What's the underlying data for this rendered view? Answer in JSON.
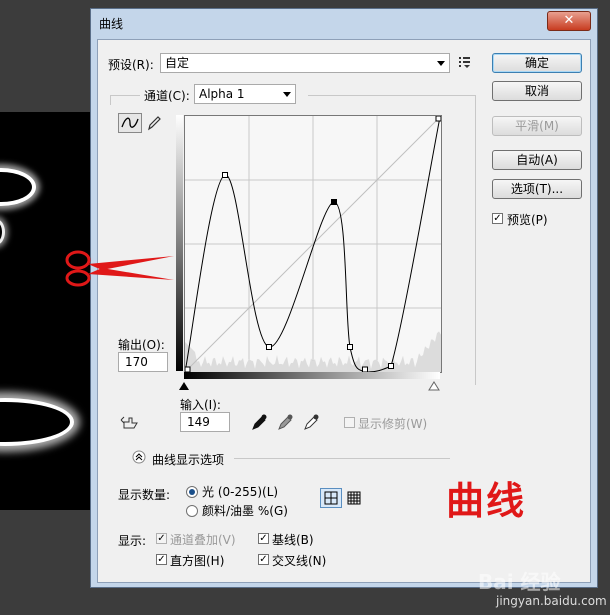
{
  "title": "曲线",
  "close_label": "✕",
  "preset": {
    "label": "预设(R):",
    "value": "自定"
  },
  "channel": {
    "label": "通道(C):",
    "value": "Alpha 1"
  },
  "buttons": {
    "ok": "确定",
    "cancel": "取消",
    "smooth": "平滑(M)",
    "auto": "自动(A)",
    "options": "选项(T)..."
  },
  "preview_label": "预览(P)",
  "output": {
    "label": "输出(O):",
    "value": "170"
  },
  "input": {
    "label": "输入(I):",
    "value": "149"
  },
  "show_clipping_label": "显示修剪(W)",
  "curve_display_options_label": "曲线显示选项",
  "show_amount": {
    "label": "显示数量:",
    "light": "光 (0-255)(L)",
    "pigment": "颜料/油墨 %(G)",
    "selected": "light"
  },
  "show": {
    "label": "显示:",
    "channel_overlays": "通道叠加(V)",
    "baseline": "基线(B)",
    "histogram": "直方图(H)",
    "intersection": "交叉线(N)"
  },
  "annotation": "曲线",
  "watermark": {
    "brand": "Bai 经验",
    "url": "jingyan.baidu.com"
  },
  "colors": {
    "dialog_border": "#5a6e88",
    "annotation_red": "#e01818"
  },
  "curve_points": [
    [
      0,
      0
    ],
    [
      40,
      197
    ],
    [
      84,
      25
    ],
    [
      149,
      170
    ],
    [
      165,
      25
    ],
    [
      180,
      0
    ],
    [
      206,
      6
    ],
    [
      255,
      255
    ]
  ]
}
